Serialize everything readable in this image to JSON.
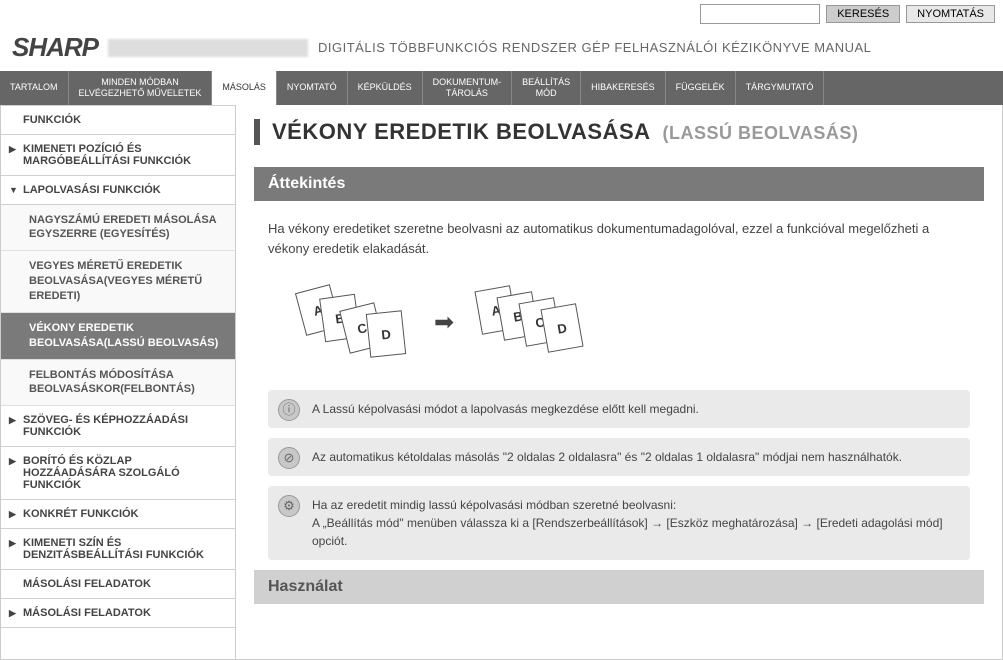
{
  "topbar": {
    "search_btn": "KERESÉS",
    "print_btn": "NYOMTATÁS"
  },
  "header": {
    "logo": "SHARP",
    "text": "DIGITÁLIS TÖBBFUNKCIÓS RENDSZER GÉP FELHASZNÁLÓI KÉZIKÖNYVE MANUAL"
  },
  "tabs": [
    "TARTALOM",
    "MINDEN MÓDBAN\nELVÉGEZHETŐ MŰVELETEK",
    "MÁSOLÁS",
    "NYOMTATÓ",
    "KÉPKÜLDÉS",
    "DOKUMENTUM-\nTÁROLÁS",
    "BEÁLLÍTÁS\nMÓD",
    "HIBAKERESÉS",
    "FÜGGELÉK",
    "TÁRGYMUTATÓ"
  ],
  "tabs_active_index": 2,
  "sidebar": {
    "items": [
      {
        "type": "nav",
        "label": "FUNKCIÓK",
        "caret": "",
        "cls": "top-cut"
      },
      {
        "type": "nav",
        "label": "KIMENETI POZÍCIÓ ÉS MARGÓBEÁLLÍTÁSI FUNKCIÓK",
        "caret": "▶"
      },
      {
        "type": "nav",
        "label": "LAPOLVASÁSI FUNKCIÓK",
        "caret": "▼"
      },
      {
        "type": "sub",
        "label": "NAGYSZÁMÚ EREDETI MÁSOLÁSA EGYSZERRE (EGYESÍTÉS)"
      },
      {
        "type": "sub",
        "label": "VEGYES MÉRETŰ EREDETIK BEOLVASÁSA(VEGYES MÉRETŰ EREDETI)"
      },
      {
        "type": "sub",
        "label": "VÉKONY EREDETIK BEOLVASÁSA(LASSÚ BEOLVASÁS)",
        "selected": true
      },
      {
        "type": "sub",
        "label": "FELBONTÁS MÓDOSÍTÁSA BEOLVASÁSKOR(FELBONTÁS)"
      },
      {
        "type": "nav",
        "label": "SZÖVEG- ÉS KÉPHOZZÁADÁSI FUNKCIÓK",
        "caret": "▶"
      },
      {
        "type": "nav",
        "label": "BORÍTÓ ÉS KÖZLAP HOZZÁADÁSÁRA SZOLGÁLÓ FUNKCIÓK",
        "caret": "▶"
      },
      {
        "type": "nav",
        "label": "KONKRÉT FUNKCIÓK",
        "caret": "▶"
      },
      {
        "type": "nav",
        "label": "KIMENETI SZÍN ÉS DENZITÁSBEÁLLÍTÁSI FUNKCIÓK",
        "caret": "▶"
      },
      {
        "type": "nav",
        "label": "MÁSOLÁSI FELADATOK",
        "caret": ""
      },
      {
        "type": "nav",
        "label": "MÁSOLÁSI FELADATOK",
        "caret": "▶"
      }
    ]
  },
  "page": {
    "title": "VÉKONY EREDETIK BEOLVASÁSA",
    "subtitle": "(LASSÚ BEOLVASÁS)",
    "overview_hdr": "Áttekintés",
    "overview_text": "Ha vékony eredetiket szeretne beolvasni az automatikus dokumentumadagolóval, ezzel a funkcióval megelőzheti a vékony eredetik elakadását.",
    "notes": [
      "A Lassú képolvasási módot a lapolvasás megkezdése előtt kell megadni.",
      "Az automatikus kétoldalas másolás \"2 oldalas 2 oldalasra\" és \"2 oldalas 1 oldalasra\" módjai nem használhatók.",
      "Ha az eredetit mindig lassú képolvasási módban szeretné beolvasni:\nA „Beállítás mód\" menüben válassza ki a [Rendszerbeállítások] → [Eszköz meghatározása] → [Eredeti adagolási mód] opciót."
    ],
    "usage_hdr": "Használat"
  }
}
